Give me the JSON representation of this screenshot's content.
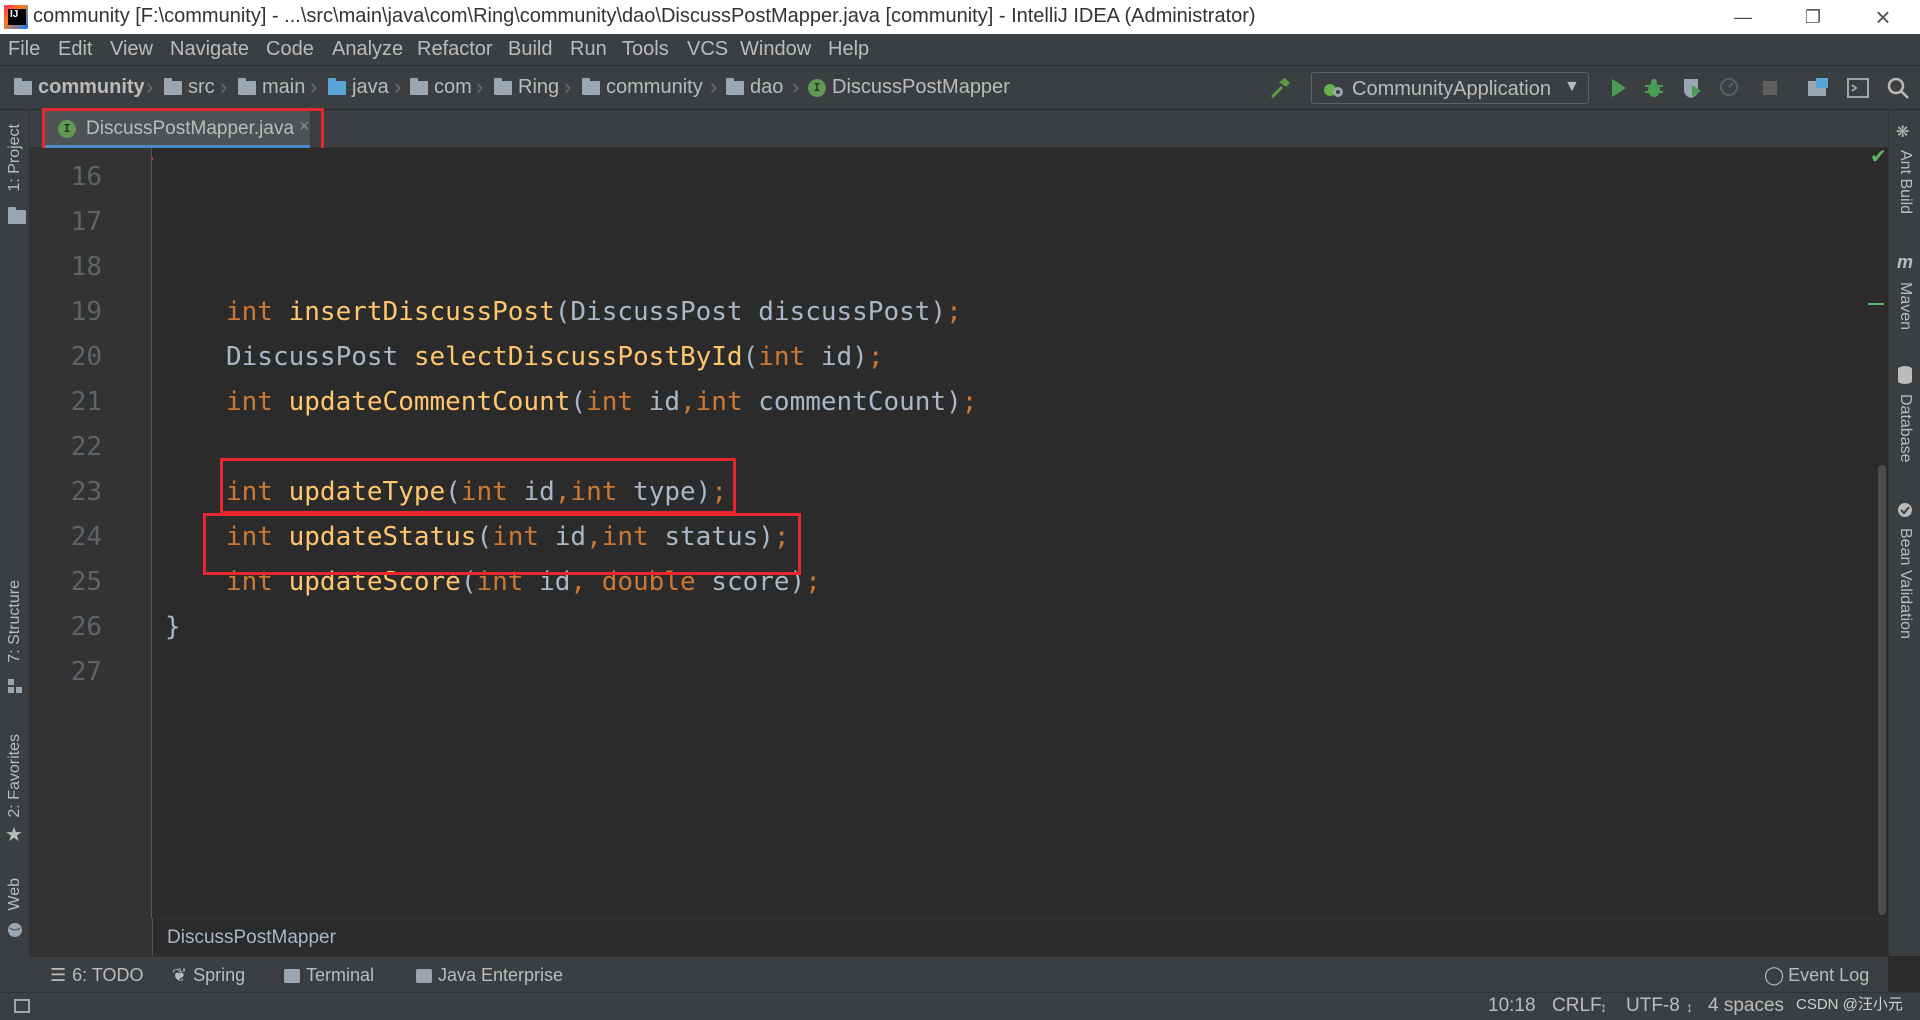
{
  "window": {
    "title": "community [F:\\community] - ...\\src\\main\\java\\com\\Ring\\community\\dao\\DiscussPostMapper.java [community] - IntelliJ IDEA (Administrator)"
  },
  "menu": [
    "File",
    "Edit",
    "View",
    "Navigate",
    "Code",
    "Analyze",
    "Refactor",
    "Build",
    "Run",
    "Tools",
    "VCS",
    "Window",
    "Help"
  ],
  "breadcrumbs": [
    "community",
    "src",
    "main",
    "java",
    "com",
    "Ring",
    "community",
    "dao",
    "DiscussPostMapper"
  ],
  "run_config": {
    "label": "CommunityApplication"
  },
  "editor_tab": {
    "label": "DiscussPostMapper.java",
    "close": "×"
  },
  "left_tools": {
    "project": "1: Project",
    "structure": "7: Structure",
    "favorites": "2: Favorites",
    "web": "Web"
  },
  "right_tools": {
    "ant": "Ant Build",
    "maven": "Maven",
    "database": "Database",
    "bean": "Bean Validation"
  },
  "line_numbers": [
    "16",
    "17",
    "18",
    "19",
    "20",
    "21",
    "22",
    "23",
    "24",
    "25",
    "26",
    "27"
  ],
  "code": {
    "l19": {
      "t1": "int",
      "t2": "insertDiscussPost",
      "t3": "(DiscussPost discussPost)",
      "t4": ";"
    },
    "l20": {
      "t1": "DiscussPost ",
      "t2": "selectDiscussPostById",
      "t3": "(",
      "t4": "int",
      "t5": " id)",
      "t6": ";"
    },
    "l21": {
      "t1": "int",
      "t2": "updateCommentCount",
      "t3": "(",
      "t4": "int",
      "t5": " id",
      "t6": ",",
      "t7": "int",
      "t8": " commentCount)",
      "t9": ";"
    },
    "l23": {
      "t1": "int",
      "t2": "updateType",
      "t3": "(",
      "t4": "int",
      "t5": " id",
      "t6": ",",
      "t7": "int",
      "t8": " type)",
      "t9": ";"
    },
    "l24": {
      "t1": "int",
      "t2": "updateStatus",
      "t3": "(",
      "t4": "int",
      "t5": " id",
      "t6": ",",
      "t7": "int",
      "t8": " status)",
      "t9": ";"
    },
    "l25": {
      "t1": "int",
      "t2": "updateScore",
      "t3": "(",
      "t4": "int",
      "t5": " id",
      "t6": ", ",
      "t7": "double",
      "t8": " score)",
      "t9": ";"
    },
    "l26": {
      "t1": "}"
    }
  },
  "structure_crumb": "DiscussPostMapper",
  "tool_windows": {
    "todo": "6: TODO",
    "spring": "Spring",
    "terminal": "Terminal",
    "java_enterprise": "Java Enterprise",
    "event_log": "Event Log"
  },
  "status": {
    "position": "10:18",
    "line_sep": "CRLF",
    "encoding": "UTF-8",
    "indent": "4 spaces",
    "watermark": "CSDN @汪小元"
  },
  "colors": {
    "keyword": "#cc7832",
    "method": "#ffc66d",
    "text": "#a9b7c6",
    "highlight_box": "#e8262d"
  }
}
